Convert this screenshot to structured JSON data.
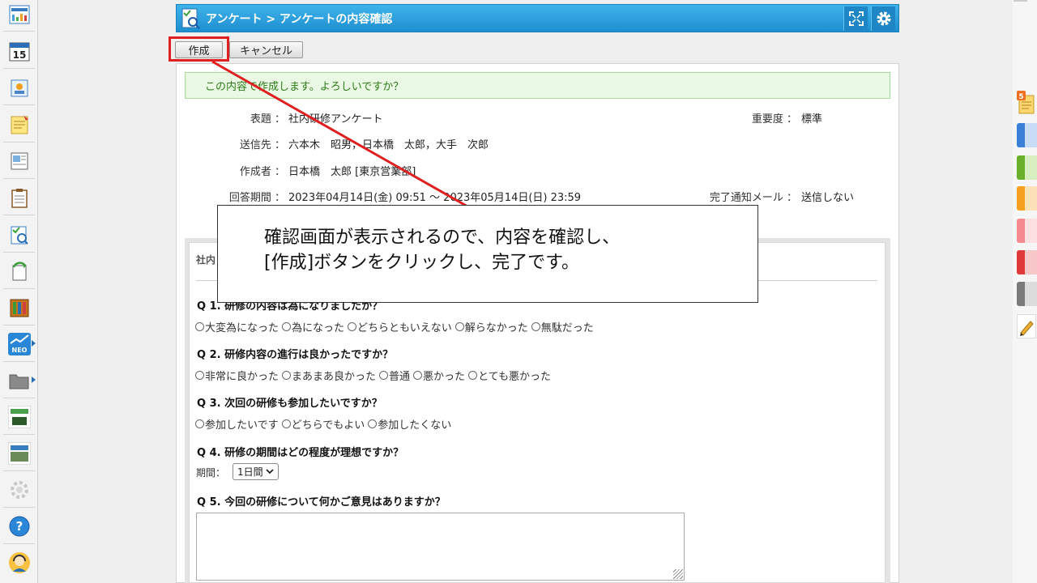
{
  "window": {
    "breadcrumb": "アンケート > アンケートの内容確認"
  },
  "toolbar": {
    "create_label": "作成",
    "cancel_label": "キャンセル"
  },
  "confirm_message": "この内容で作成します。よろしいですか？",
  "meta": {
    "subject_label": "表題 ：",
    "subject_value": "社内研修アンケート",
    "importance_label": "重要度 ：",
    "importance_value": "標準",
    "recipients_label": "送信先 ：",
    "recipients_value": "六本木　昭男，日本橋　太郎，大手　次郎",
    "author_label": "作成者 ：",
    "author_value": "日本橋　太郎 [東京営業部]",
    "period_label": "回答期間 ：",
    "period_value": "2023年04月14日(金) 09:51 ～ 2023年05月14日(日) 23:59",
    "notify_label": "完了通知メール ：",
    "notify_value": "送信しない"
  },
  "survey": {
    "heading": "社内",
    "questions": [
      {
        "title": "Q 1. 研修の内容は為になりましたか？",
        "options": [
          "大変為になった",
          "為になった",
          "どちらともいえない",
          "解らなかった",
          "無駄だった"
        ]
      },
      {
        "title": "Q 2. 研修内容の進行は良かったですか？",
        "options": [
          "非常に良かった",
          "まあまあ良かった",
          "普通",
          "悪かった",
          "とても悪かった"
        ]
      },
      {
        "title": "Q 3. 次回の研修も参加したいですか？",
        "options": [
          "参加したいです",
          "どちらでもよい",
          "参加したくない"
        ]
      },
      {
        "title": "Q 4. 研修の期間はどの程度が理想ですか？"
      },
      {
        "title": "Q 5. 今回の研修について何かご意見はありますか？"
      }
    ],
    "period_field_label": "期間：",
    "period_field_value": "1日間"
  },
  "callout": {
    "line1": "確認画面が表示されるので、内容を確認し、",
    "line2": "[作成]ボタンをクリックし、完了です。"
  },
  "rail": {
    "calendar_day": "15",
    "neo_label": "NEO",
    "badge_count": "5"
  },
  "colors": {
    "titlebar": "#1d8fd1",
    "highlight": "#e02020",
    "confirm_bg": "#eaf9e4",
    "confirm_text": "#2d7a18"
  }
}
